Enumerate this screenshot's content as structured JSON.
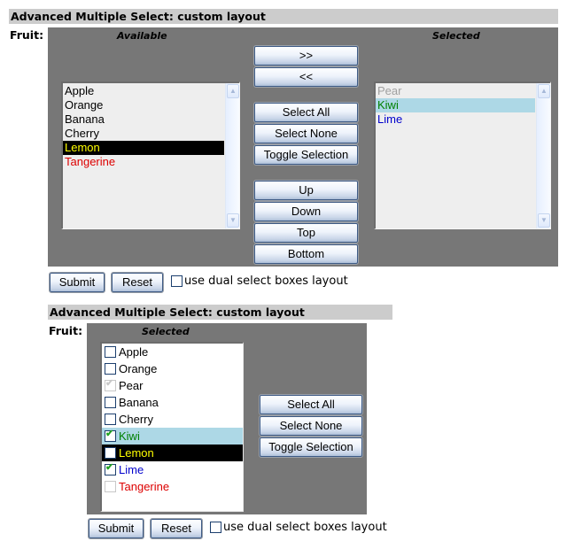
{
  "colors": {
    "header_bg": "#cccccc",
    "panel_bg": "#777777",
    "list_bg": "#eeeeee",
    "highlight_black": "#000000",
    "highlight_lightblue": "#add8e6",
    "text_yellow": "#ffff00",
    "text_red": "#dd0000",
    "text_green": "#008000",
    "text_blue": "#0000cc",
    "text_gray": "#a0a0a0"
  },
  "form1": {
    "title": "Advanced Multiple Select: custom layout",
    "field_label": "Fruit:",
    "available_title": "Available",
    "selected_title": "Selected",
    "available": [
      {
        "label": "Apple",
        "style": "normal"
      },
      {
        "label": "Orange",
        "style": "normal"
      },
      {
        "label": "Banana",
        "style": "normal"
      },
      {
        "label": "Cherry",
        "style": "normal"
      },
      {
        "label": "Lemon",
        "style": "highlight-black"
      },
      {
        "label": "Tangerine",
        "style": "red"
      }
    ],
    "selected": [
      {
        "label": "Pear",
        "style": "disabled"
      },
      {
        "label": "Kiwi",
        "style": "highlight-lightblue"
      },
      {
        "label": "Lime",
        "style": "blue"
      }
    ],
    "buttons": {
      "add": ">>",
      "remove": "<<",
      "select_all": "Select All",
      "select_none": "Select None",
      "toggle": "Toggle Selection",
      "up": "Up",
      "down": "Down",
      "top": "Top",
      "bottom": "Bottom"
    },
    "submit": "Submit",
    "reset": "Reset",
    "dual_checkbox_label": "use dual select boxes layout",
    "dual_checked": false
  },
  "form2": {
    "title": "Advanced Multiple Select: custom layout",
    "field_label": "Fruit:",
    "selected_title": "Selected",
    "items": [
      {
        "label": "Apple",
        "checked": false,
        "disabled": false,
        "style": "normal"
      },
      {
        "label": "Orange",
        "checked": false,
        "disabled": false,
        "style": "normal"
      },
      {
        "label": "Pear",
        "checked": true,
        "disabled": true,
        "style": "normal"
      },
      {
        "label": "Banana",
        "checked": false,
        "disabled": false,
        "style": "normal"
      },
      {
        "label": "Cherry",
        "checked": false,
        "disabled": false,
        "style": "normal"
      },
      {
        "label": "Kiwi",
        "checked": true,
        "disabled": false,
        "style": "highlight-lightblue"
      },
      {
        "label": "Lemon",
        "checked": false,
        "disabled": false,
        "style": "highlight-black"
      },
      {
        "label": "Lime",
        "checked": true,
        "disabled": false,
        "style": "blue"
      },
      {
        "label": "Tangerine",
        "checked": false,
        "disabled": true,
        "style": "red"
      }
    ],
    "buttons": {
      "select_all": "Select All",
      "select_none": "Select None",
      "toggle": "Toggle Selection"
    },
    "submit": "Submit",
    "reset": "Reset",
    "dual_checkbox_label": "use dual select boxes layout",
    "dual_checked": false
  }
}
